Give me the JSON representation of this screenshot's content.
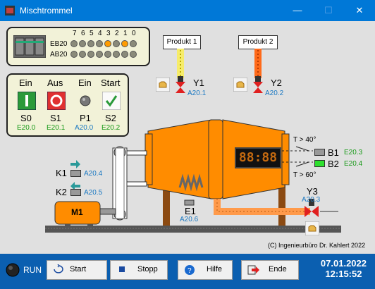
{
  "window": {
    "title": "Mischtrommel"
  },
  "plc": {
    "bit_labels": [
      "7",
      "6",
      "5",
      "4",
      "3",
      "2",
      "1",
      "0"
    ],
    "rows": [
      {
        "label": "EB20",
        "leds": [
          "off",
          "off",
          "off",
          "off",
          "on",
          "off",
          "on",
          "off"
        ]
      },
      {
        "label": "AB20",
        "leds": [
          "off",
          "off",
          "off",
          "off",
          "off",
          "off",
          "off",
          "off"
        ]
      }
    ]
  },
  "controls": {
    "s0": {
      "top": "Ein",
      "name": "S0",
      "addr": "E20.0"
    },
    "s1": {
      "top": "Aus",
      "name": "S1",
      "addr": "E20.1"
    },
    "p1": {
      "top": "Ein",
      "name": "P1",
      "addr": "A20.0"
    },
    "s2": {
      "top": "Start",
      "name": "S2",
      "addr": "E20.2"
    }
  },
  "products": {
    "p1": {
      "label": "Produkt 1",
      "valve": "Y1",
      "addr": "A20.1"
    },
    "p2": {
      "label": "Produkt 2",
      "valve": "Y2",
      "addr": "A20.2"
    }
  },
  "sensors": {
    "t_high": "T > 40°",
    "t_low": "T > 60°",
    "b1": {
      "name": "B1",
      "addr": "E20.3"
    },
    "b2": {
      "name": "B2",
      "addr": "E20.4"
    }
  },
  "drive": {
    "k1": {
      "name": "K1",
      "addr": "A20.4"
    },
    "k2": {
      "name": "K2",
      "addr": "A20.5"
    },
    "motor": "M1",
    "e1": {
      "name": "E1",
      "addr": "A20.6"
    }
  },
  "outlet": {
    "valve": "Y3",
    "addr": "A20.3"
  },
  "display_digits": "88:88",
  "copyright": "(C) Ingenieurbüro Dr. Kahlert 2022",
  "toolbar": {
    "run_label": "RUN",
    "start": "Start",
    "stop": "Stopp",
    "help": "Hilfe",
    "end": "Ende"
  },
  "clock": {
    "date": "07.01.2022",
    "time": "12:15:52"
  },
  "colors": {
    "titlebar": "#0078d7",
    "bottombar": "#0b5fb0",
    "drum": "#ff8c00",
    "led_on": "#ff9c00"
  }
}
